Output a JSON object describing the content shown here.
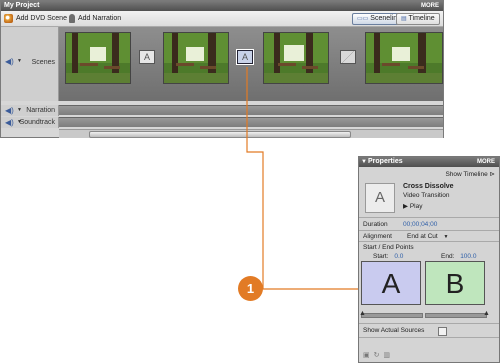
{
  "project": {
    "title": "My Project",
    "more": "MORE",
    "toolbar": {
      "add_dvd_scene": "Add DVD Scene",
      "add_narration": "Add Narration",
      "sceneline": "Sceneline",
      "timeline": "Timeline"
    },
    "tracks": {
      "scenes": "Scenes",
      "narration": "Narration",
      "soundtrack": "Soundtrack"
    }
  },
  "callout": {
    "number": "1"
  },
  "properties": {
    "title": "Properties",
    "more": "MORE",
    "show_timeline": "Show Timeline",
    "effect_name": "Cross Dissolve",
    "effect_type": "Video Transition",
    "play": "Play",
    "duration_label": "Duration",
    "duration_value": "00;00;04;00",
    "alignment_label": "Alignment",
    "alignment_value": "End at Cut",
    "start_end_label": "Start / End Points",
    "start_label": "Start:",
    "start_value": "0.0",
    "end_label": "End:",
    "end_value": "100.0",
    "box_a": "A",
    "box_b": "B",
    "show_actual_sources": "Show Actual Sources",
    "transition_glyph": "A"
  },
  "colors": {
    "callout": "#e27b25",
    "callout_line": "#e27b25",
    "box_a": "#c9cbef",
    "box_b": "#bfe6bd"
  }
}
